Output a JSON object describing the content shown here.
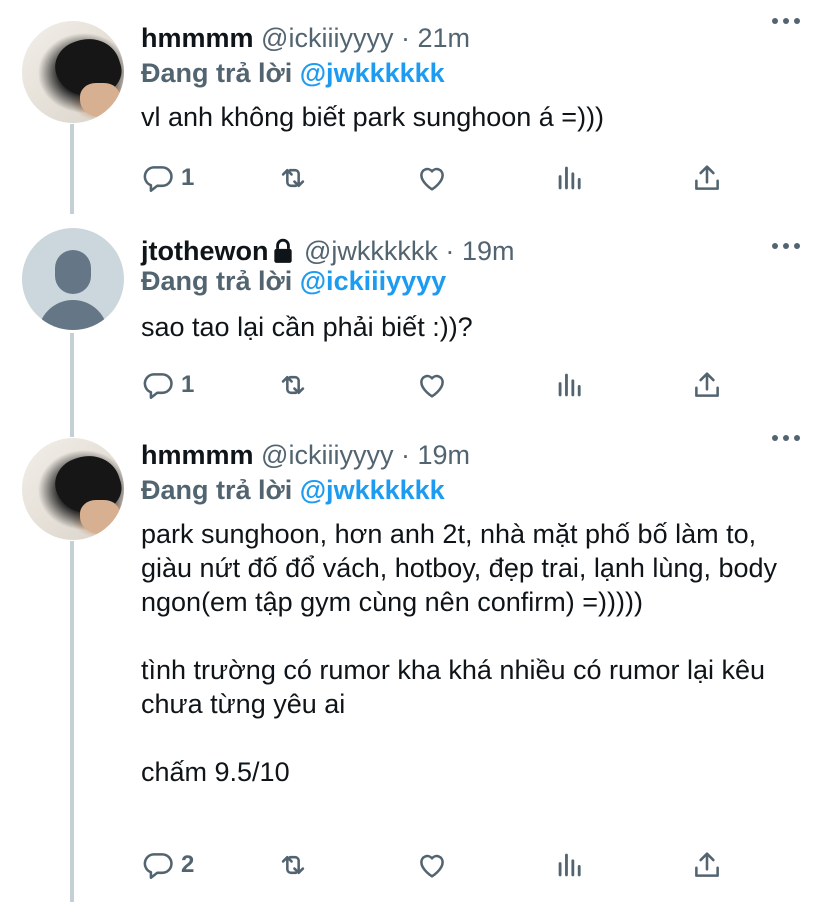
{
  "tweets": [
    {
      "display_name": "hmmmm",
      "handle": "@ickiiiyyyy",
      "separator": "·",
      "time": "21m",
      "locked": false,
      "replying_prefix": "Đang trả lời",
      "replying_to": "@jwkkkkkk",
      "paragraphs": [
        "vl anh không biết park sunghoon á =)))"
      ],
      "reply_count": "1"
    },
    {
      "display_name": "jtothewon",
      "handle": "@jwkkkkkk",
      "separator": "·",
      "time": "19m",
      "locked": true,
      "replying_prefix": "Đang trả lời",
      "replying_to": "@ickiiiyyyy",
      "paragraphs": [
        "sao tao lại cần phải biết :))?"
      ],
      "reply_count": "1"
    },
    {
      "display_name": "hmmmm",
      "handle": "@ickiiiyyyy",
      "separator": "·",
      "time": "19m",
      "locked": false,
      "replying_prefix": "Đang trả lời",
      "replying_to": "@jwkkkkkk",
      "paragraphs": [
        "park sunghoon, hơn anh 2t, nhà mặt phố bố làm to, giàu nứt đố đổ vách, hotboy, đẹp trai, lạnh lùng, body ngon(em tập gym cùng nên confirm) =)))))",
        "tình trường có rumor kha khá nhiều có rumor lại kêu chưa từng yêu ai",
        "chấm 9.5/10"
      ],
      "reply_count": "2"
    }
  ],
  "icons": {
    "reply": "reply-icon",
    "retweet": "retweet-icon",
    "like": "heart-icon",
    "analytics": "analytics-icon",
    "share": "share-icon",
    "more": "more-icon",
    "lock": "lock-icon"
  },
  "colors": {
    "text": "#0f1419",
    "secondary": "#536471",
    "accent": "#1d9bf0",
    "thread_line": "#c4cfd6"
  }
}
